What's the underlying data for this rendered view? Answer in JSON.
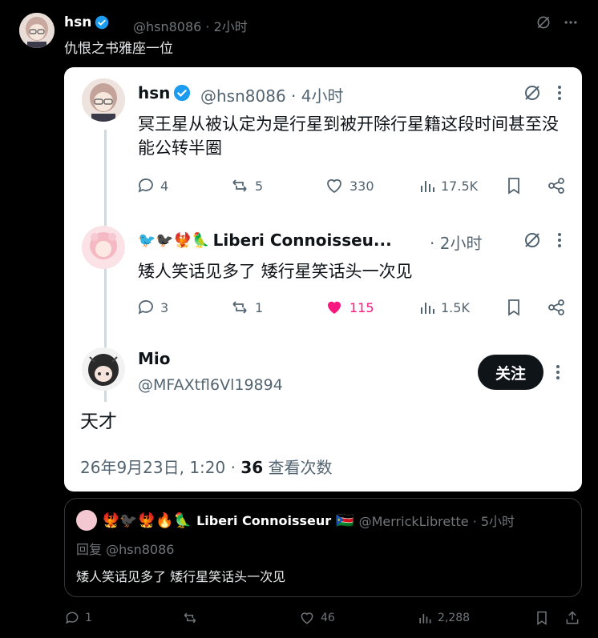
{
  "outer": {
    "name": "hsn",
    "handle_time": "@hsn8086 · 2小时",
    "text": "仇恨之书雅座一位"
  },
  "card": {
    "post1": {
      "name": "hsn",
      "handle_time": "@hsn8086 · 4小时",
      "text": "冥王星从被认定为是行星到被开除行星籍这段时间甚至没能公转半圈",
      "replies": "4",
      "reposts": "5",
      "likes": "330",
      "views": "17.5K"
    },
    "post2": {
      "name": "Liberi Connoisseu...",
      "time": "· 2小时",
      "text": "矮人笑话见多了 矮行星笑话头一次见",
      "replies": "3",
      "reposts": "1",
      "likes": "115",
      "views": "1.5K"
    },
    "post3": {
      "name": "Mio",
      "handle": "@MFAXtfl6Vl19894",
      "follow_label": "关注",
      "text": "天才",
      "date": "26年9月23日, 1:20 · ",
      "view_count": "36",
      "view_label": " 查看次数"
    }
  },
  "reply": {
    "name": "Liberi Connoisseur",
    "handle_time": "@MerrickLibrette · 5小时",
    "reply_to": "回复 @hsn8086",
    "text": "矮人笑话见多了 矮行星笑话头一次见"
  },
  "bottom": {
    "replies": "1",
    "likes": "46",
    "views": "2,288"
  },
  "colors": {
    "verified": "#1d9bf0",
    "like_pink": "#f91880",
    "dark_bg": "#000000",
    "card_bg": "#ffffff"
  }
}
